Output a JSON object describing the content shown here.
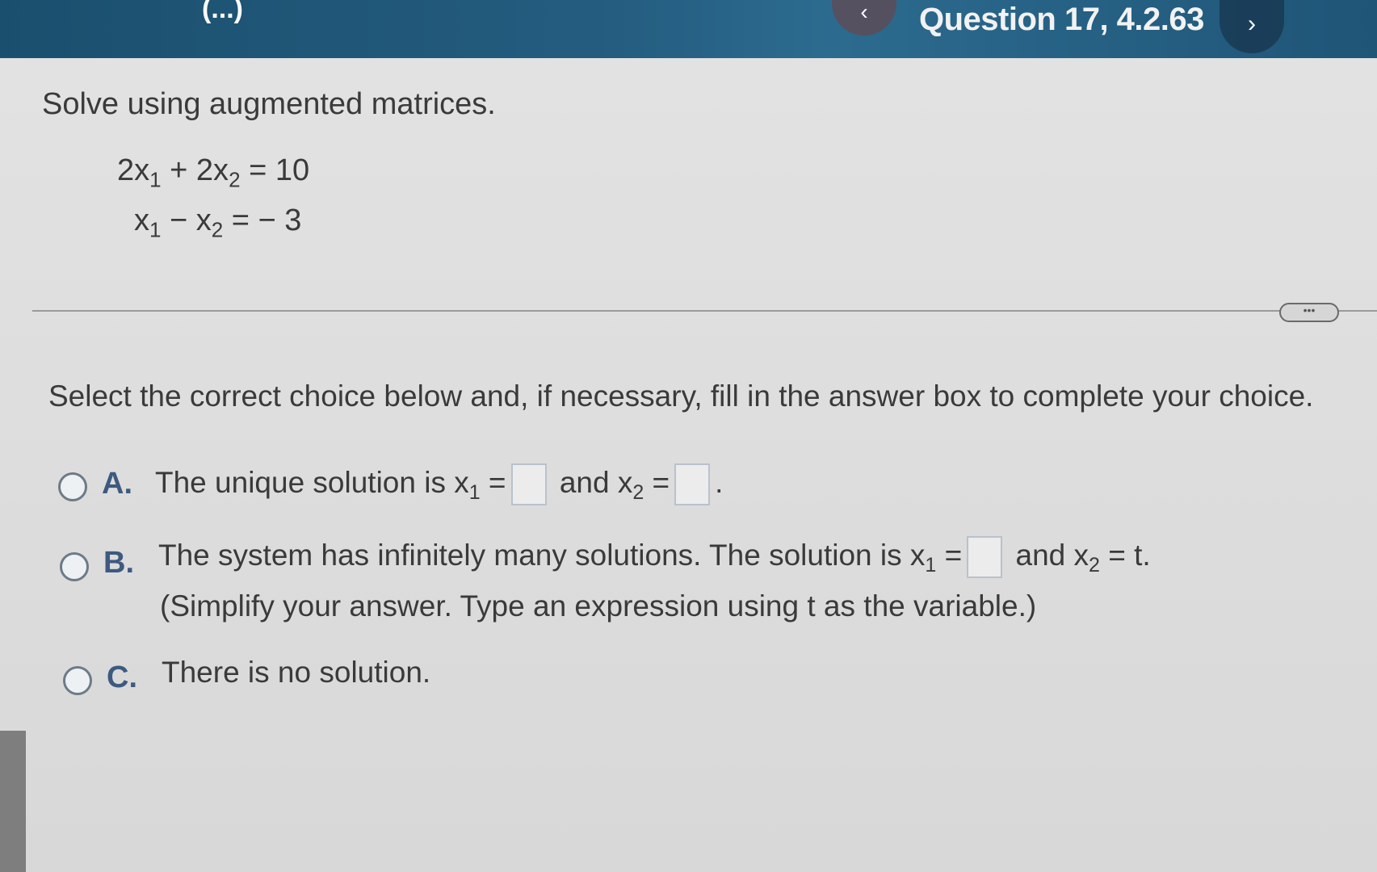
{
  "header": {
    "partial_label": "(...)",
    "question_title": "Question 17, 4.2.63",
    "prev_icon": "chevron-left-icon",
    "next_icon": "chevron-right-icon"
  },
  "problem": {
    "prompt": "Solve using augmented matrices.",
    "equation1": {
      "c1": "2x",
      "s1": "1",
      "op": " + 2x",
      "s2": "2",
      "rhs": " =  10"
    },
    "equation2": {
      "c1": "x",
      "s1": "1",
      "op": " −  x",
      "s2": "2",
      "rhs": " = − 3"
    }
  },
  "more_label": "•••",
  "instruction": "Select the correct choice below and, if necessary, fill in the answer box to complete your choice.",
  "choices": {
    "a": {
      "letter": "A.",
      "text1": "The unique solution is x",
      "sub1": "1",
      "eq1": " =",
      "text2": " and x",
      "sub2": "2",
      "eq2": " =",
      "end": "."
    },
    "b": {
      "letter": "B.",
      "text1": "The system has infinitely many solutions. The solution is x",
      "sub1": "1",
      "eq1": " =",
      "text2": " and x",
      "sub2": "2",
      "end": " = t.",
      "note": "(Simplify your answer. Type an expression using t as the variable.)"
    },
    "c": {
      "letter": "C.",
      "text": "There is no solution."
    }
  },
  "colors": {
    "header": "#1b4f6e",
    "letter": "#3d5a80",
    "background": "#dcdcdc"
  }
}
